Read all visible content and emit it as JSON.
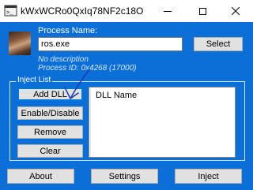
{
  "window": {
    "title": "kWxWCRo0QxIq78NF2c18O",
    "controls": {
      "minimize": "minimize",
      "maximize": "maximize",
      "close": "close"
    }
  },
  "process": {
    "label": "Process Name:",
    "value": "ros.exe",
    "select_label": "Select",
    "description": "No description",
    "process_id": "Process ID: 0x4268 (17000)"
  },
  "inject_list": {
    "label": "Inject List",
    "buttons": {
      "add": "Add DLL",
      "enable_disable": "Enable/Disable",
      "remove": "Remove",
      "clear": "Clear"
    },
    "columns": [
      "DLL Name"
    ],
    "rows": []
  },
  "footer": {
    "about": "About",
    "settings": "Settings",
    "inject": "Inject"
  },
  "colors": {
    "window_bg": "#0a6fd7",
    "annotation_stroke": "#1b3bb5"
  },
  "icons": {
    "app": "app-icon",
    "avatar": "process-avatar"
  }
}
